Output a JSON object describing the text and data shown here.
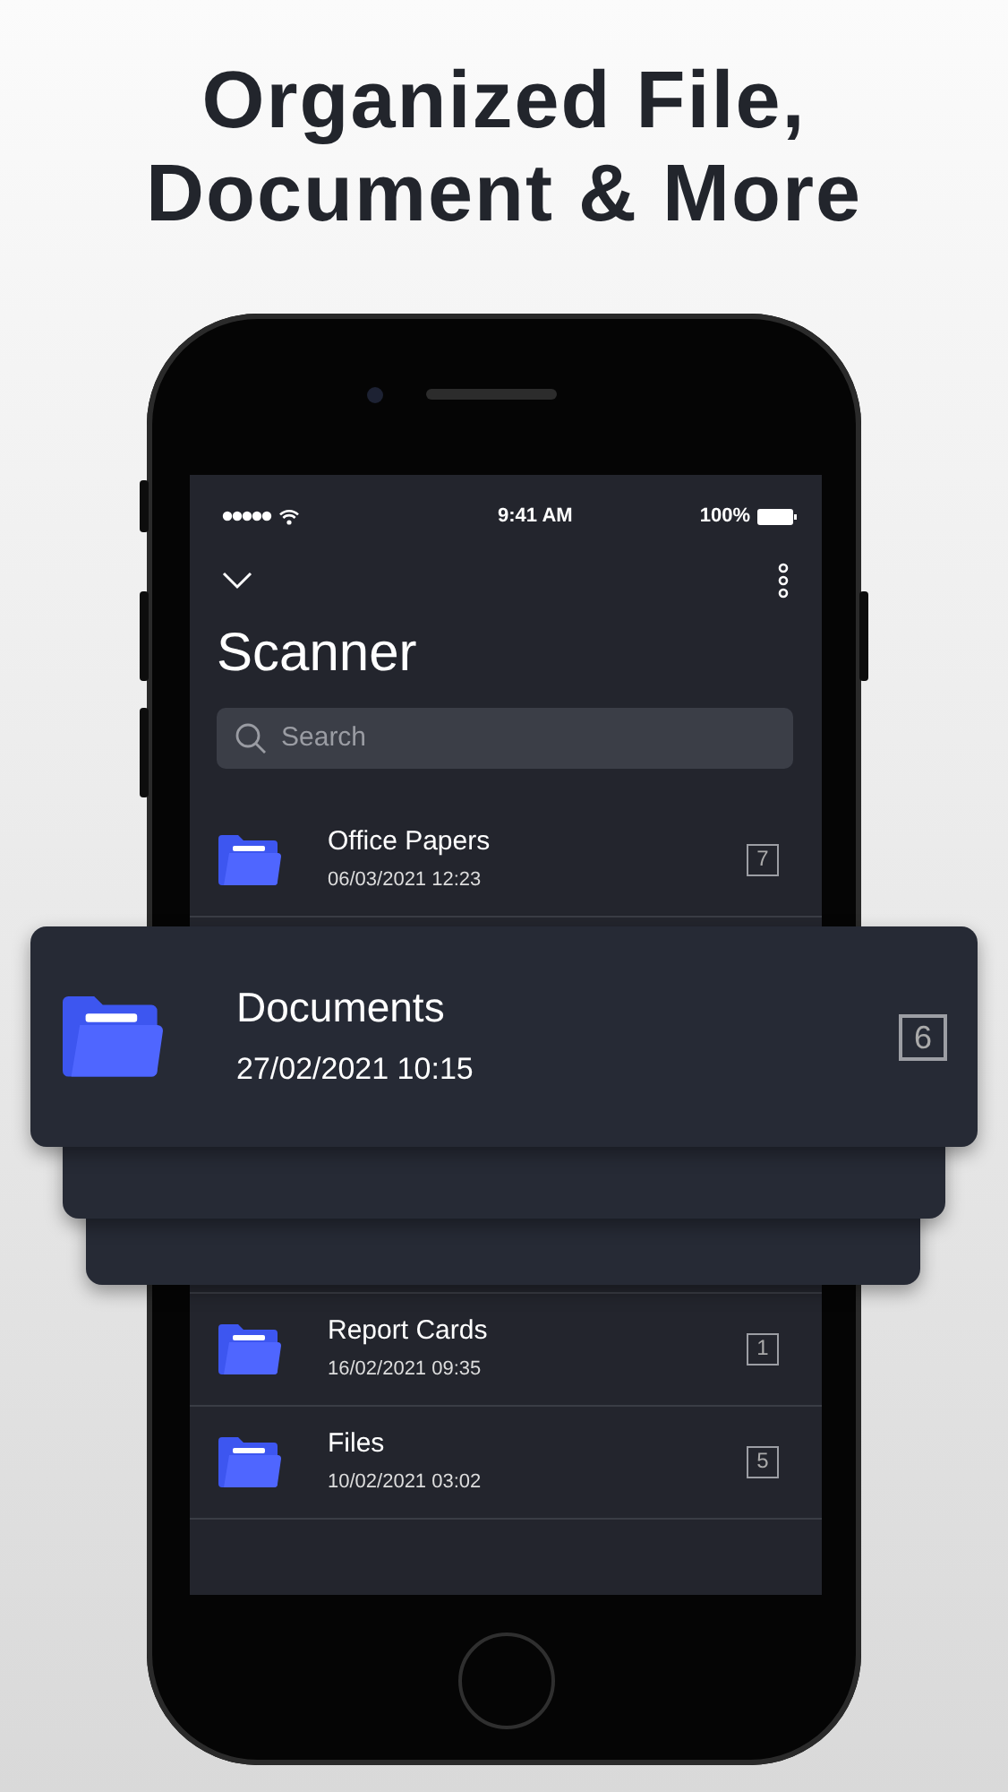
{
  "headline": "Organized File, Document & More",
  "status_bar": {
    "time": "9:41 AM",
    "battery": "100%"
  },
  "app": {
    "title": "Scanner",
    "search": {
      "placeholder": "Search"
    }
  },
  "folders": [
    {
      "name": "Office Papers",
      "date": "06/03/2021 12:23",
      "count": "7"
    },
    {
      "kind": "hidden"
    },
    {
      "name": "Report Cards",
      "date": "16/02/2021 09:35",
      "count": "1"
    },
    {
      "name": "Files",
      "date": "10/02/2021 03:02",
      "count": "5"
    }
  ],
  "dragged_folder": {
    "name": "Documents",
    "date": "27/02/2021 10:15",
    "count": "6"
  }
}
